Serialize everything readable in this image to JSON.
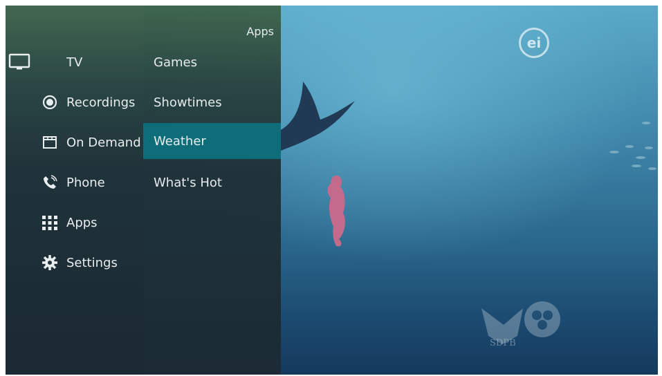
{
  "main_menu": {
    "items": [
      {
        "label": "TV",
        "icon": "tv-icon"
      },
      {
        "label": "Recordings",
        "icon": "record-icon"
      },
      {
        "label": "On Demand",
        "icon": "film-icon"
      },
      {
        "label": "Phone",
        "icon": "phone-icon"
      },
      {
        "label": "Apps",
        "icon": "grid-icon"
      },
      {
        "label": "Settings",
        "icon": "gear-icon"
      }
    ]
  },
  "apps_menu": {
    "header": "Apps",
    "items": [
      "Games",
      "Showtimes",
      "Weather",
      "What's Hot"
    ],
    "selected": "Weather"
  },
  "overlay": {
    "channel_bug": "ei",
    "watermark": "SDPB"
  },
  "colors": {
    "accent_selected": "#0e6d79",
    "text": "#e9eef0"
  }
}
